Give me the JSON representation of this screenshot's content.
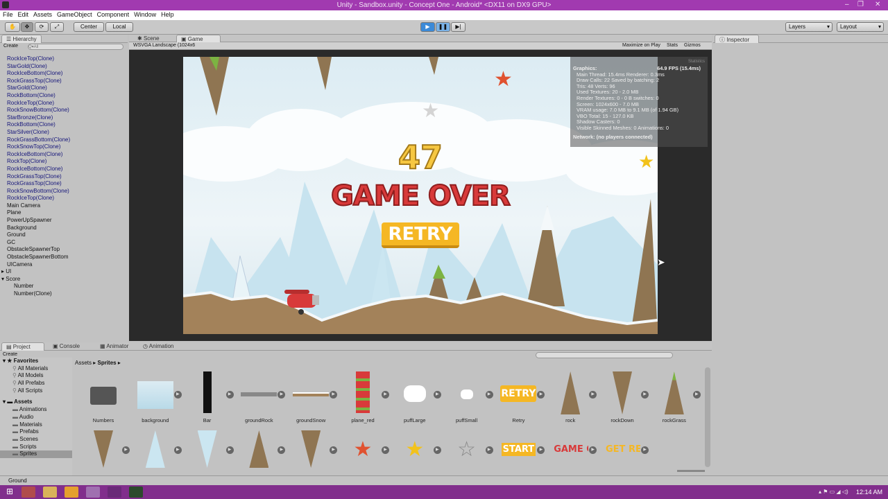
{
  "window": {
    "title": "Unity - Sandbox.unity - Concept One - Android* <DX11 on DX9 GPU>"
  },
  "menu": [
    "File",
    "Edit",
    "Assets",
    "GameObject",
    "Component",
    "Window",
    "Help"
  ],
  "toolbar": {
    "center": "Center",
    "local": "Local",
    "layers": "Layers",
    "layout": "Layout"
  },
  "hierarchy": {
    "tab": "Hierarchy",
    "create": "Create",
    "search_placeholder": "Q▾All",
    "items": [
      "RockIceTop(Clone)",
      "StarGold(Clone)",
      "RockIceBottom(Clone)",
      "RockGrassTop(Clone)",
      "StarGold(Clone)",
      "RockBottom(Clone)",
      "RockIceTop(Clone)",
      "RockSnowBottom(Clone)",
      "StarBronze(Clone)",
      "RockBottom(Clone)",
      "StarSilver(Clone)",
      "RockGrassBottom(Clone)",
      "RockSnowTop(Clone)",
      "RockIceBottom(Clone)",
      "RockTop(Clone)",
      "RockIceBottom(Clone)",
      "RockGrassTop(Clone)",
      "RockGrassTop(Clone)",
      "RockSnowBottom(Clone)",
      "RockIceTop(Clone)",
      "Main Camera",
      "Plane",
      "PowerUpSpawner",
      "Background",
      "Ground",
      "GC",
      "ObstacleSpawnerTop",
      "ObstacleSpawnerBottom",
      "UICamera",
      "UI",
      "Score",
      "Number",
      "Number(Clone)"
    ]
  },
  "tabs": {
    "scene": "Scene",
    "game": "Game",
    "inspector": "Inspector",
    "project": "Project",
    "console": "Console",
    "animator": "Animator",
    "animation": "Animation"
  },
  "game": {
    "aspect": "WSVGA Landscape (1024x6",
    "maximize": "Maximize on Play",
    "stats": "Stats",
    "gizmos": "Gizmos",
    "score": "47",
    "game_over": "GAME OVER",
    "retry": "RETRY"
  },
  "stats": {
    "header": "Statistics",
    "graphics": "Graphics:",
    "fps": "64.9 FPS (15.4ms)",
    "lines": [
      "Main Thread: 15.4ms   Renderer: 0.3ms",
      "Draw Calls: 22     Saved by batching: 2",
      "Tris: 48    Verts: 96",
      "Used Textures: 20 - 2.0 MB",
      "Render Textures: 0 - 0 B   switches: 0",
      "Screen: 1024x600 - 7.0 MB",
      "VRAM usage: 7.0 MB to 9.1 MB (of 1.94 GB)",
      "VBO Total: 15 - 127.0 KB",
      "Shadow Casters: 0",
      "Visible Skinned Meshes: 0     Animations: 0"
    ],
    "network": "Network: (no players connected)"
  },
  "project": {
    "create": "Create",
    "breadcrumb_root": "Assets",
    "breadcrumb_leaf": "Sprites",
    "favorites": "Favorites",
    "fav_items": [
      "All Materials",
      "All Models",
      "All Prefabs",
      "All Scripts"
    ],
    "assets_root": "Assets",
    "folders": [
      "Animations",
      "Audio",
      "Materials",
      "Prefabs",
      "Scenes",
      "Scripts",
      "Sprites"
    ],
    "row1": [
      "Numbers",
      "background",
      "Bar",
      "groundRock",
      "groundSnow",
      "plane_red",
      "puffLarge",
      "puffSmall",
      "Retry",
      "rock",
      "rockDown",
      "rockGrass"
    ],
    "row2_labels": {
      "start": "START",
      "gameover": "GAME OVER",
      "getready": "GET READY"
    }
  },
  "status": {
    "text": "Ground"
  },
  "taskbar": {
    "time": "12:14 AM"
  },
  "colors": {
    "title_bar": "#a13ab0",
    "taskbar": "#812e8c",
    "game_over_red": "#d83a3a",
    "retry_gold": "#f5b724",
    "sky": "#dcecf3",
    "ground": "#a3825a"
  }
}
